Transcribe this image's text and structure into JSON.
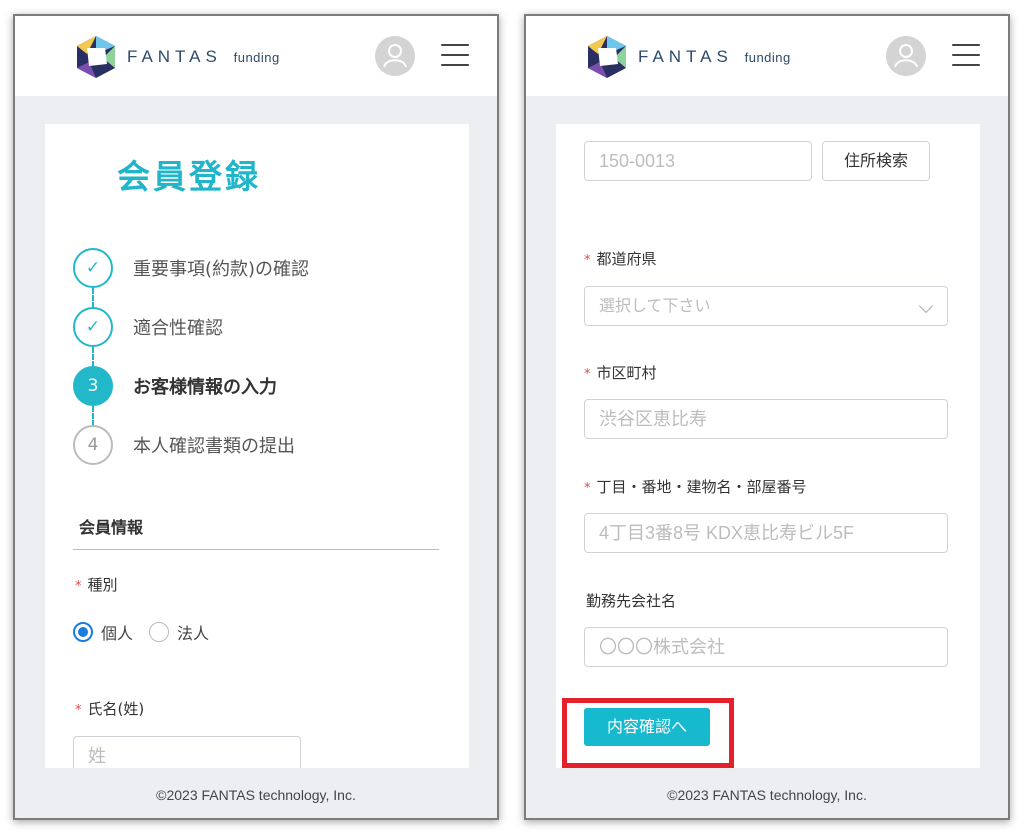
{
  "header": {
    "brand": "FANTAS",
    "brand_sub": "funding",
    "icons": [
      "logo-icon",
      "user-avatar-icon",
      "hamburger-menu-icon"
    ]
  },
  "left": {
    "title": "会員登録",
    "steps": [
      {
        "marker": "✓",
        "label": "重要事項(約款)の確認",
        "state": "done"
      },
      {
        "marker": "✓",
        "label": "適合性確認",
        "state": "done"
      },
      {
        "marker": "3",
        "label": "お客様情報の入力",
        "state": "active"
      },
      {
        "marker": "4",
        "label": "本人確認書類の提出",
        "state": "pending"
      }
    ],
    "section_title": "会員情報",
    "type_label": "種別",
    "radio_individual": "個人",
    "radio_corporate": "法人",
    "lastname_label": "氏名(姓)",
    "lastname_placeholder": "姓"
  },
  "right": {
    "postal_placeholder": "150-0013",
    "address_search_label": "住所検索",
    "prefecture_label": "都道府県",
    "prefecture_placeholder": "選択して下さい",
    "city_label": "市区町村",
    "city_placeholder": "渋谷区恵比寿",
    "street_label": "丁目・番地・建物名・部屋番号",
    "street_placeholder": "4丁目3番8号 KDX恵比寿ビル5F",
    "company_label": "勤務先会社名",
    "company_placeholder": "〇〇〇株式会社",
    "confirm_button": "内容確認へ"
  },
  "footer": {
    "copyright": "©2023 FANTAS technology, Inc."
  },
  "colors": {
    "accent": "#22b8c9",
    "required": "#e84a4a",
    "highlight": "#e4212a",
    "radio": "#1a7be0"
  }
}
